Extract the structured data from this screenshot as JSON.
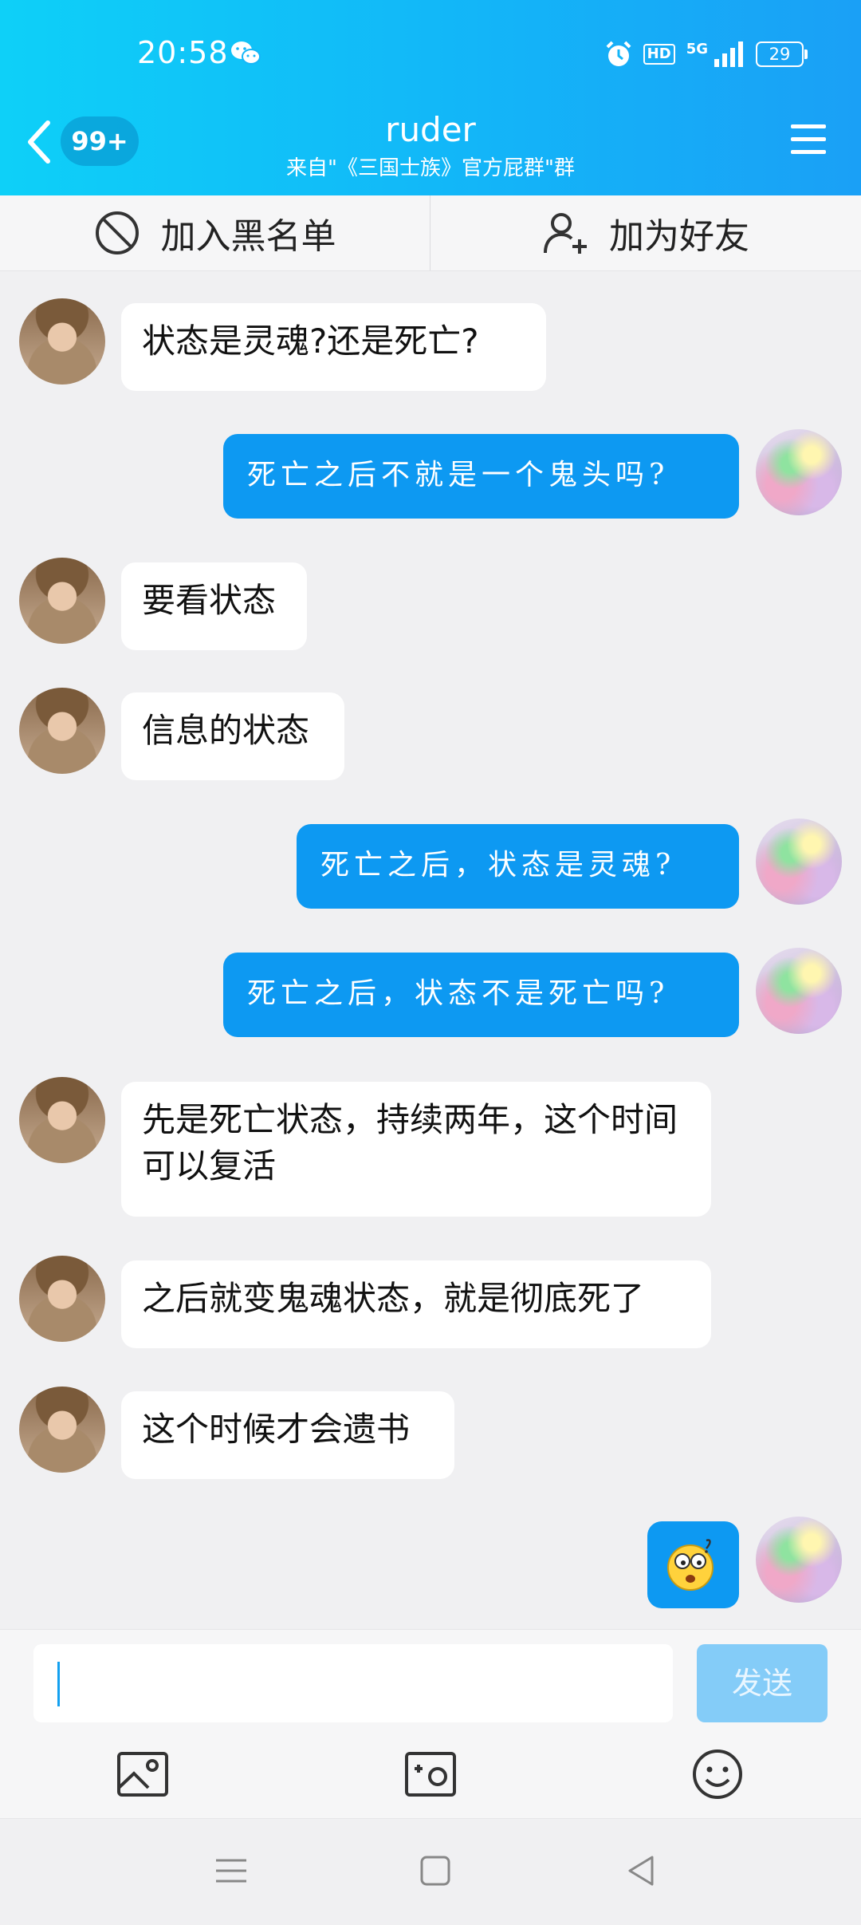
{
  "status_bar": {
    "time": "20:58",
    "hd": "HD",
    "network": "5G",
    "battery": "29"
  },
  "header": {
    "badge": "99+",
    "name": "ruder",
    "subtitle": "来自\"《三国士族》官方屁群\"群"
  },
  "actions": {
    "blacklist": "加入黑名单",
    "add_friend": "加为好友"
  },
  "messages": [
    {
      "side": "received",
      "text": "状态是灵魂?还是死亡?"
    },
    {
      "side": "sent",
      "text": "死亡之后不就是一个鬼头吗?"
    },
    {
      "side": "received",
      "text": "要看状态"
    },
    {
      "side": "received",
      "text": "信息的状态"
    },
    {
      "side": "sent",
      "text": "死亡之后，状态是灵魂?"
    },
    {
      "side": "sent",
      "text": "死亡之后，状态不是死亡吗?"
    },
    {
      "side": "received",
      "text": "先是死亡状态，持续两年，这个时间可以复活"
    },
    {
      "side": "received",
      "text": "之后就变鬼魂状态，就是彻底死了"
    },
    {
      "side": "received",
      "text": "这个时候才会遗书"
    },
    {
      "side": "sent",
      "type": "emoji",
      "icon": "surprised-emoji"
    }
  ],
  "input": {
    "value": "",
    "send_label": "发送"
  },
  "colors": {
    "header_start": "#0ed0f8",
    "header_end": "#1aa0f6",
    "sent_bubble": "#0d99f2",
    "send_disabled": "#84ccf8"
  }
}
